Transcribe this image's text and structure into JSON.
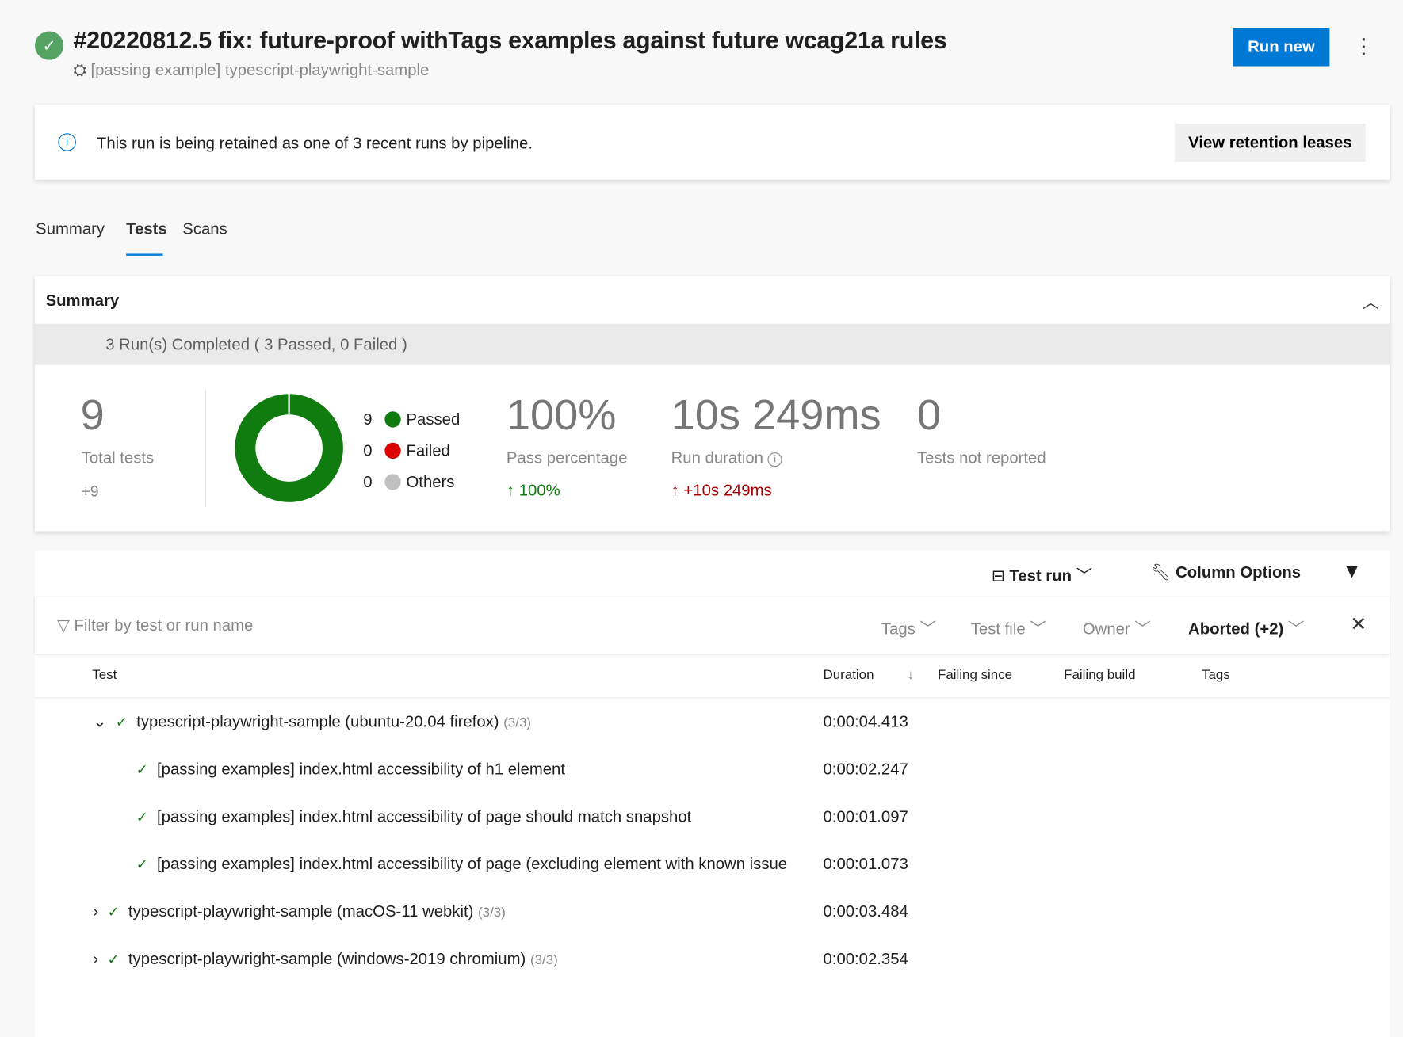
{
  "header": {
    "title": "#20220812.5 fix: future-proof withTags examples against future wcag21a rules",
    "subtitle": "[passing example] typescript-playwright-sample",
    "run_new": "Run new",
    "more": "⋮",
    "status_icon": "check-circle-icon"
  },
  "banner": {
    "text": "This run is being retained as one of 3 recent runs by pipeline.",
    "button": "View retention leases"
  },
  "tabs": [
    {
      "label": "Summary"
    },
    {
      "label": "Tests",
      "active": true
    },
    {
      "label": "Scans"
    }
  ],
  "summary": {
    "heading": "Summary",
    "runs": "3 Run(s) Completed ( 3 Passed, 0 Failed )",
    "total": "9",
    "total_label": "Total tests",
    "total_delta": "+9",
    "legend": [
      {
        "count": "9",
        "label": "Passed",
        "color": "#107c10"
      },
      {
        "count": "0",
        "label": "Failed",
        "color": "#dc0000"
      },
      {
        "count": "0",
        "label": "Others",
        "color": "#c0c0c0"
      }
    ],
    "pass_pct": "100%",
    "pass_label": "Pass percentage",
    "pass_delta": "100%",
    "duration": "10s 249ms",
    "duration_label": "Run duration",
    "duration_delta": "+10s 249ms",
    "not_reported": "0",
    "not_reported_label": "Tests not reported"
  },
  "toolbar": {
    "test_run": "Test run",
    "column_options": "Column Options"
  },
  "filters": {
    "placeholder": "Filter by test or run name",
    "tags": "Tags",
    "test_file": "Test file",
    "owner": "Owner",
    "outcome": "Aborted (+2)"
  },
  "columns": {
    "test": "Test",
    "duration": "Duration",
    "failing_since": "Failing since",
    "failing_build": "Failing build",
    "tags": "Tags"
  },
  "rows": [
    {
      "name": "typescript-playwright-sample (ubuntu-20.04 firefox)",
      "count": "(3/3)",
      "duration": "0:00:04.413",
      "expanded": true
    },
    {
      "name": "[passing examples] index.html accessibility of h1 element",
      "duration": "0:00:02.247"
    },
    {
      "name": "[passing examples] index.html accessibility of page should match snapshot",
      "duration": "0:00:01.097"
    },
    {
      "name": "[passing examples] index.html accessibility of page (excluding element with known issue",
      "duration": "0:00:01.073"
    },
    {
      "name": "typescript-playwright-sample (macOS-11 webkit)",
      "count": "(3/3)",
      "duration": "0:00:03.484"
    },
    {
      "name": "typescript-playwright-sample (windows-2019 chromium)",
      "count": "(3/3)",
      "duration": "0:00:02.354"
    }
  ]
}
